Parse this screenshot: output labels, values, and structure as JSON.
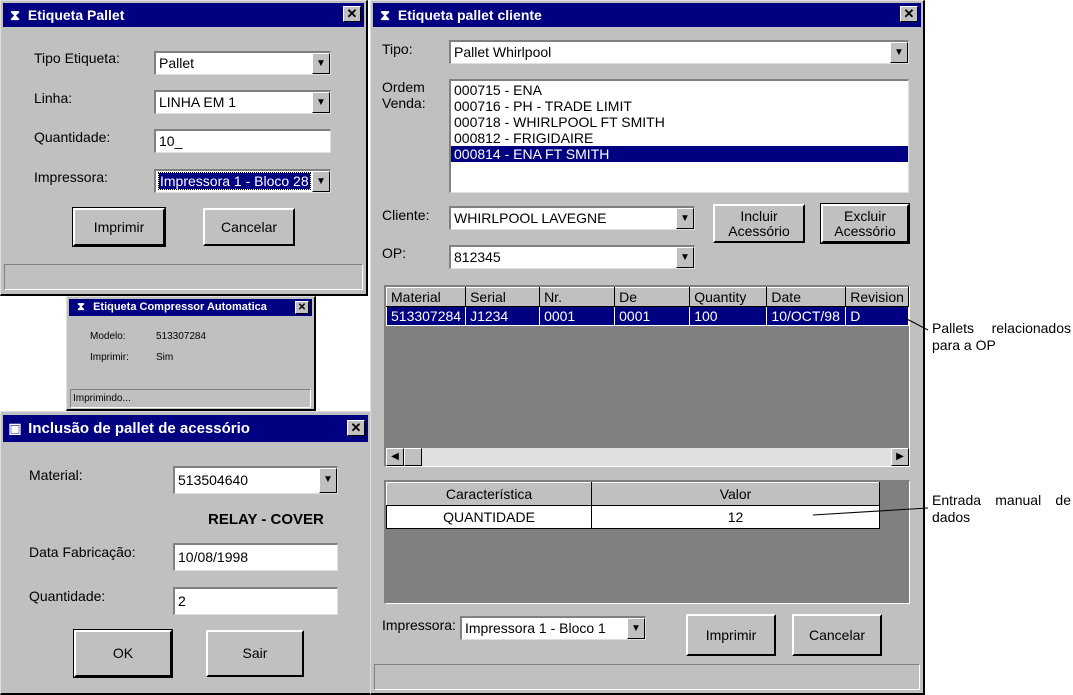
{
  "win1": {
    "title": "Etiqueta Pallet",
    "tipo_label": "Tipo Etiqueta:",
    "tipo_value": "Pallet",
    "linha_label": "Linha:",
    "linha_value": "LINHA EM 1",
    "qtd_label": "Quantidade:",
    "qtd_value": "10_",
    "imp_label": "Impressora:",
    "imp_value": "Impressora 1 - Bloco 28",
    "print_btn": "Imprimir",
    "cancel_btn": "Cancelar"
  },
  "win2": {
    "title": "Etiqueta Compressor Automatica",
    "modelo_label": "Modelo:",
    "modelo_value": "513307284",
    "imprimir_label": "Imprimir:",
    "imprimir_value": "Sim",
    "status": "Imprimindo..."
  },
  "win3": {
    "title": "Inclusão de pallet de acessório",
    "material_label": "Material:",
    "material_value": "513504640",
    "desc": "RELAY - COVER",
    "data_label": "Data Fabricação:",
    "data_value": "10/08/1998",
    "qtd_label": "Quantidade:",
    "qtd_value": "2",
    "ok_btn": "OK",
    "exit_btn": "Sair"
  },
  "win4": {
    "title": "Etiqueta pallet cliente",
    "tipo_label": "Tipo:",
    "tipo_value": "Pallet Whirlpool",
    "ordem_label_1": "Ordem",
    "ordem_label_2": "Venda:",
    "orders": [
      "000715 - ENA",
      "000716 - PH - TRADE LIMIT",
      "000718 - WHIRLPOOL FT SMITH",
      "000812 - FRIGIDAIRE",
      "000814 - ENA FT SMITH"
    ],
    "cliente_label": "Cliente:",
    "cliente_value": "WHIRLPOOL LAVEGNE",
    "incluir_1": "Incluir",
    "incluir_2": "Acessório",
    "excluir_1": "Excluir",
    "excluir_2": "Acessório",
    "op_label": "OP:",
    "op_value": "812345",
    "grid_headers": [
      "Material",
      "Serial",
      "Nr.",
      "De",
      "Quantity",
      "Date",
      "Revision"
    ],
    "grid_row": [
      "513307284",
      "J1234",
      "0001",
      "0001",
      "100",
      "10/OCT/98",
      "D"
    ],
    "char_headers": [
      "Característica",
      "Valor"
    ],
    "char_row": [
      "QUANTIDADE",
      "12"
    ],
    "imp_label": "Impressora:",
    "imp_value": "Impressora 1 - Bloco 1",
    "print_btn": "Imprimir",
    "cancel_btn": "Cancelar"
  },
  "annotations": {
    "pallets_1": "Pallets relacionados",
    "pallets_2": "para a OP",
    "entrada_1": "Entrada manual de",
    "entrada_2": "dados"
  },
  "icons": {
    "title_icon": "app-icon",
    "close": "close-icon",
    "dropdown": "chevron-down-icon"
  },
  "colors": {
    "title_bar": "#000080",
    "window_face": "#c0c0c0",
    "selection": "#000080"
  }
}
